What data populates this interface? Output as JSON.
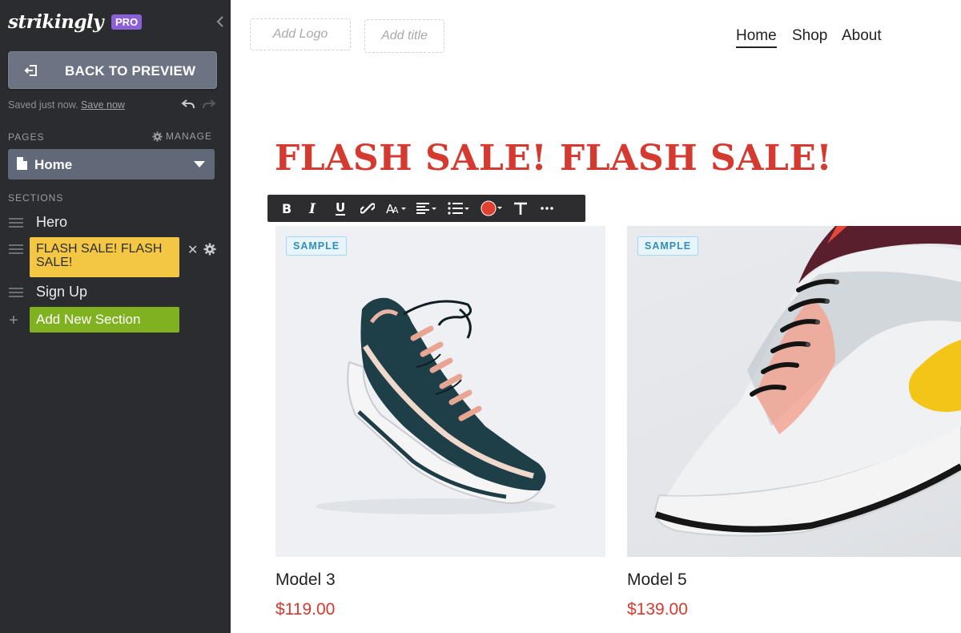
{
  "sidebar": {
    "brand": "strikingly",
    "badge": "PRO",
    "back_label": "BACK TO PREVIEW",
    "saved_text": "Saved just now.",
    "save_now": "Save now",
    "pages_label": "PAGES",
    "manage_label": "MANAGE",
    "current_page": "Home",
    "sections_label": "SECTIONS",
    "sections": [
      {
        "label": "Hero"
      },
      {
        "label": "FLASH SALE! FLASH SALE!"
      },
      {
        "label": "Sign Up"
      }
    ],
    "add_section_label": "Add New Section"
  },
  "header": {
    "logo_placeholder": "Add Logo",
    "title_placeholder": "Add title",
    "nav": [
      "Home",
      "Shop",
      "About"
    ]
  },
  "headline": "FLASH SALE! FLASH SALE!",
  "toolbar": {
    "buttons": [
      "bold-icon",
      "italic-icon",
      "underline-icon",
      "link-icon",
      "font-size-icon",
      "align-icon",
      "list-icon",
      "text-color-icon",
      "text-style-icon",
      "more-icon"
    ]
  },
  "products": [
    {
      "badge": "SAMPLE",
      "name": "Model 3",
      "price": "$119.00"
    },
    {
      "badge": "SAMPLE",
      "name": "Model 5",
      "price": "$139.00"
    }
  ],
  "colors": {
    "sidebar_bg": "#2b2c30",
    "accent_red": "#d43a30",
    "active_section": "#f3c744",
    "add_section": "#7fb121",
    "pro_badge": "#8b5fd6",
    "text_color_swatch": "#e0402f"
  }
}
